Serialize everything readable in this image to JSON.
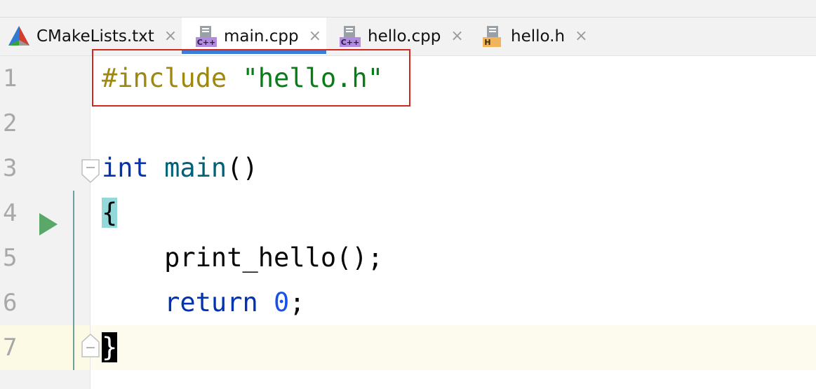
{
  "tabs": [
    {
      "label": "CMakeLists.txt",
      "icon": "cmake-icon",
      "active": false
    },
    {
      "label": "main.cpp",
      "icon": "cpp-file-icon",
      "icon_text": "C++",
      "active": true
    },
    {
      "label": "hello.cpp",
      "icon": "cpp-file-icon",
      "icon_text": "C++",
      "active": false
    },
    {
      "label": "hello.h",
      "icon": "header-file-icon",
      "icon_text": "H",
      "active": false
    }
  ],
  "close_glyph": "×",
  "editor": {
    "line_numbers": [
      "1",
      "2",
      "3",
      "4",
      "5",
      "6",
      "7"
    ],
    "lines": {
      "l1": {
        "directive": "#include",
        "space": " ",
        "path": "\"hello.h\""
      },
      "l3": {
        "kw": "int",
        "space": " ",
        "fn": "main",
        "paren": "()"
      },
      "l4": {
        "brace": "{"
      },
      "l5": {
        "indent": "    ",
        "call": "print_hello();"
      },
      "l6": {
        "indent": "    ",
        "kw": "return",
        "space": " ",
        "num": "0",
        "semi": ";"
      },
      "l7": {
        "brace": "}"
      }
    }
  },
  "colors": {
    "accent": "#3d7fd6",
    "highlight_box": "#d0281e",
    "run_icon": "#59a869",
    "preprocessor": "#9e880d",
    "string": "#067d17",
    "keyword": "#0033b3",
    "function": "#00627a",
    "number": "#1750eb",
    "brace_match": "#93d9d9"
  }
}
